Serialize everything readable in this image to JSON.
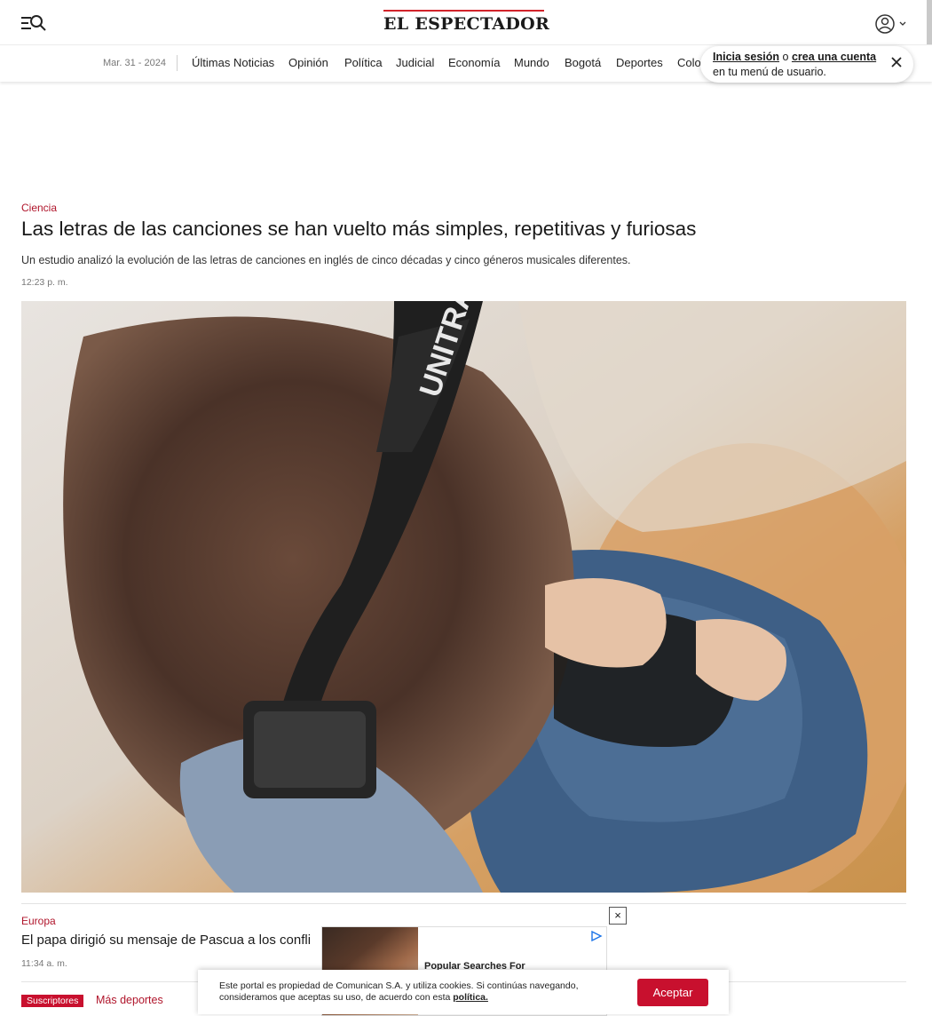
{
  "header": {
    "logo_text": "EL ESPECTADOR",
    "brand_color": "#d2232a",
    "menu_icon": "search-menu-icon",
    "user_icon": "user-circle-icon"
  },
  "nav": {
    "date": "Mar. 31 - 2024",
    "items": [
      "Últimas Noticias",
      "Opinión",
      "Política",
      "Judicial",
      "Economía",
      "Mundo",
      "Bogotá",
      "Deportes",
      "Colo"
    ]
  },
  "tooltip": {
    "login_link": "Inicia sesión",
    "connector": " o ",
    "create_link": "crea una cuenta",
    "rest": " en tu menú de usuario."
  },
  "article": {
    "category": "Ciencia",
    "headline": "Las letras de las canciones se han vuelto más simples, repetitivas y furiosas",
    "summary": "Un estudio analizó la evolución de las letras de canciones en inglés de cinco décadas y cinco géneros musicales diferentes.",
    "time": "12:23 p. m.",
    "image_brand": "UNITRA"
  },
  "article2": {
    "category": "Europa",
    "headline": "El papa dirigió su mensaje de Pascua a los confli",
    "time": "11:34 a. m."
  },
  "article3": {
    "badge": "Suscriptores",
    "category": "Más deportes"
  },
  "ad": {
    "text": "Popular Searches For",
    "close": "×"
  },
  "cookie": {
    "text": "Este portal es propiedad de Comunican S.A. y utiliza cookies. Si continúas navegando, consideramos que aceptas su uso, de acuerdo con esta ",
    "link": "política.",
    "button": "Aceptar",
    "accent": "#c8102e"
  }
}
